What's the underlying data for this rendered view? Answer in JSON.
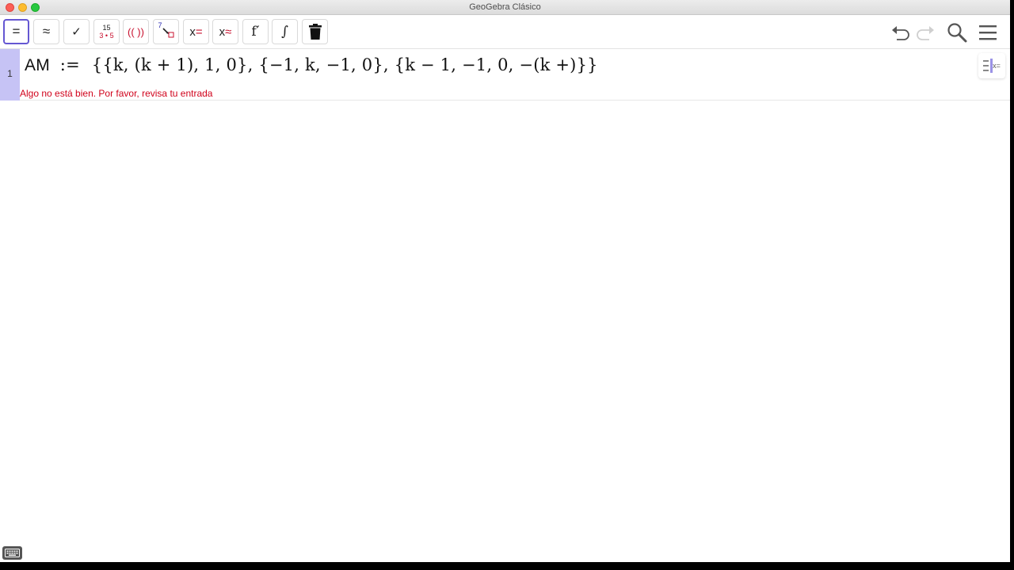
{
  "window": {
    "title": "GeoGebra Clásico"
  },
  "toolbar": {
    "buttons": [
      {
        "name": "evaluate",
        "label": "="
      },
      {
        "name": "numeric",
        "label": "≈"
      },
      {
        "name": "keep-input",
        "label": "✓"
      },
      {
        "name": "factor",
        "top": "15",
        "bottom": "3 • 5"
      },
      {
        "name": "expand",
        "label": "(( ))"
      },
      {
        "name": "substitute",
        "label": "7"
      },
      {
        "name": "solve",
        "label": "x",
        "suffix": "="
      },
      {
        "name": "solve-numerically",
        "label": "x",
        "suffix": "≈"
      },
      {
        "name": "derivative",
        "label": "f′"
      },
      {
        "name": "integral",
        "label": "∫"
      },
      {
        "name": "delete",
        "label": ""
      }
    ]
  },
  "algebra": {
    "row_number": "1",
    "label": "AM",
    "definition_op": ":=",
    "expression": "{{k, (k + 1), 1, 0}, {−1, k, −1, 0}, {k − 1, −1, 0, −(k +)}}",
    "error": "Algo no está bien. Por favor, revisa tu entrada",
    "side_button_label": "x="
  },
  "colors": {
    "accent": "#6557d2",
    "row_marker": "#c6c3f5",
    "error": "#d0021b"
  }
}
